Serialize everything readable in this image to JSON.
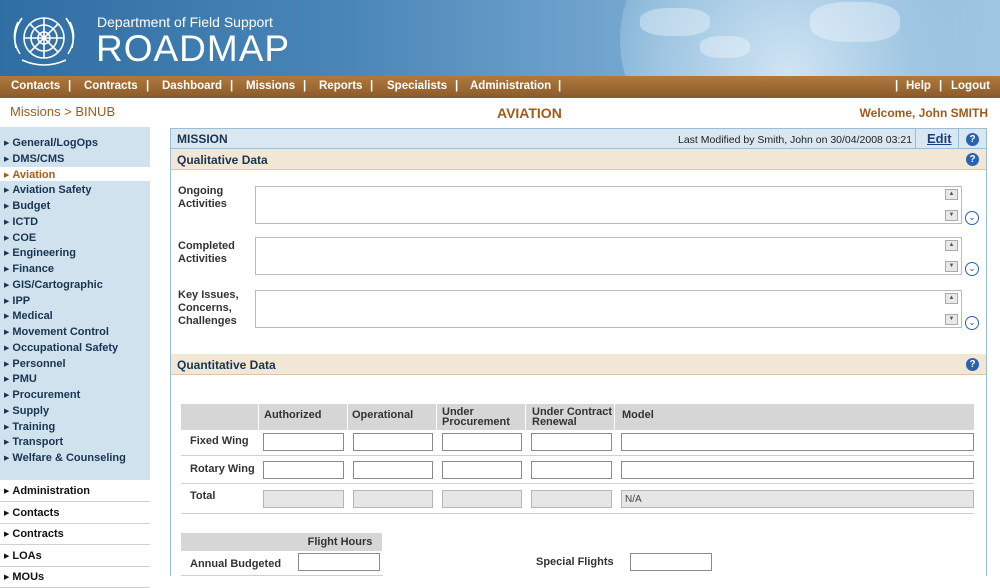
{
  "header": {
    "dept": "Department of Field Support",
    "title": "ROADMAP",
    "colors": {
      "header_blue": "#2f6ea3",
      "nav_brown": "#8a5a28",
      "accent": "#a05a1c"
    }
  },
  "nav": {
    "left": [
      "Contacts",
      "Contracts",
      "Dashboard",
      "Missions",
      "Reports",
      "Specialists",
      "Administration"
    ],
    "help": "Help",
    "logout": "Logout"
  },
  "breadcrumb": "Missions > BINUB",
  "page_title": "AVIATION",
  "welcome": "Welcome, John SMITH",
  "sidebar": {
    "items": [
      "General/LogOps",
      "DMS/CMS",
      "Aviation",
      "Aviation Safety",
      "Budget",
      "ICTD",
      "COE",
      "Engineering",
      "Finance",
      "GIS/Cartographic",
      "IPP",
      "Medical",
      "Movement Control",
      "Occupational Safety",
      "Personnel",
      "PMU",
      "Procurement",
      "Supply",
      "Training",
      "Transport",
      "Welfare & Counseling"
    ],
    "active": "Aviation",
    "secondary": [
      "Administration",
      "Contacts",
      "Contracts",
      "LOAs",
      "MOUs"
    ]
  },
  "mission": {
    "label": "MISSION",
    "last_modified": "Last Modified by Smith, John on 30/04/2008 03:21",
    "edit": "Edit"
  },
  "qualitative": {
    "title": "Qualitative Data",
    "fields": [
      {
        "label": "Ongoing\nActivities"
      },
      {
        "label": "Completed\nActivities"
      },
      {
        "label": "Key Issues,\nConcerns,\nChallenges"
      }
    ]
  },
  "quantitative": {
    "title": "Quantitative Data",
    "columns": [
      "Authorized",
      "Operational",
      "Under\nProcurement",
      "Under Contract\nRenewal",
      "Model"
    ],
    "rows": [
      "Fixed Wing",
      "Rotary Wing",
      "Total"
    ],
    "total_model_value": "N/A",
    "flight_hours_header": "Flight Hours",
    "annual_budgeted_label": "Annual Budgeted",
    "special_flights_label": "Special Flights"
  },
  "icons": {
    "help": "help-icon",
    "expand": "expand-icon",
    "logo": "un-emblem-icon"
  }
}
